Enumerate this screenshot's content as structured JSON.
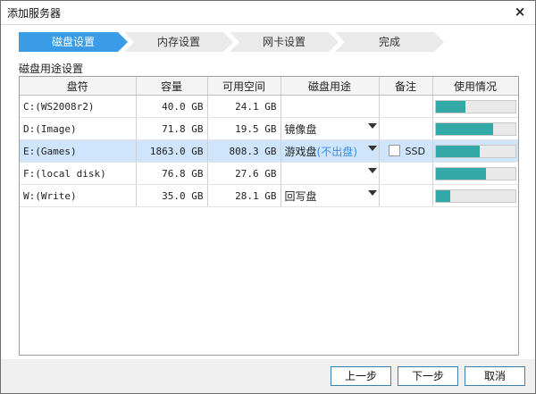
{
  "window": {
    "title": "添加服务器",
    "close_label": "×"
  },
  "steps": [
    {
      "label": "磁盘设置",
      "active": true
    },
    {
      "label": "内存设置",
      "active": false
    },
    {
      "label": "网卡设置",
      "active": false
    },
    {
      "label": "完成",
      "active": false
    }
  ],
  "section_label": "磁盘用途设置",
  "table": {
    "headers": [
      "盘符",
      "容量",
      "可用空间",
      "磁盘用途",
      "备注",
      "使用情况"
    ],
    "rows": [
      {
        "drive": "C:(WS2008r2)",
        "capacity": "40.0 GB",
        "free": "24.1 GB",
        "purpose": "",
        "purpose_hint": "",
        "dropdown": false,
        "note": "",
        "has_checkbox": false,
        "usage": 0.38,
        "selected": false
      },
      {
        "drive": "D:(Image)",
        "capacity": "71.8 GB",
        "free": "19.5 GB",
        "purpose": "镜像盘",
        "purpose_hint": "",
        "dropdown": true,
        "note": "",
        "has_checkbox": false,
        "usage": 0.72,
        "selected": false
      },
      {
        "drive": "E:(Games)",
        "capacity": "1863.0 GB",
        "free": "808.3 GB",
        "purpose": "游戏盘",
        "purpose_hint": "(不出盘)",
        "dropdown": true,
        "note": "SSD",
        "has_checkbox": true,
        "usage": 0.56,
        "selected": true
      },
      {
        "drive": "F:(local disk)",
        "capacity": "76.8 GB",
        "free": "27.6 GB",
        "purpose": "",
        "purpose_hint": "",
        "dropdown": true,
        "note": "",
        "has_checkbox": false,
        "usage": 0.64,
        "selected": false
      },
      {
        "drive": "W:(Write)",
        "capacity": "35.0 GB",
        "free": "28.1 GB",
        "purpose": "回写盘",
        "purpose_hint": "",
        "dropdown": true,
        "note": "",
        "has_checkbox": false,
        "usage": 0.18,
        "selected": false
      }
    ]
  },
  "buttons": {
    "prev": "上一步",
    "next": "下一步",
    "cancel": "取消"
  },
  "colors": {
    "accent": "#3a9be6",
    "usage_fill": "#33a9a7",
    "selected_row": "#cfe5fb",
    "hint": "#3a8ee6"
  }
}
